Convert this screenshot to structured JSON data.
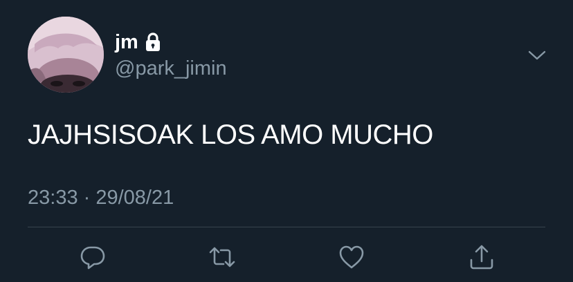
{
  "tweet": {
    "display_name": "jm",
    "handle": "@park_jimin",
    "protected_icon": "lock-icon",
    "text": "JAJHSISOAK LOS AMO MUCHO",
    "timestamp": "23:33 · 29/08/21"
  },
  "actions": [
    {
      "icon": "reply-icon"
    },
    {
      "icon": "retweet-icon"
    },
    {
      "icon": "like-icon"
    },
    {
      "icon": "share-icon"
    }
  ],
  "colors": {
    "background": "#15202b",
    "primary_text": "#ffffff",
    "secondary_text": "#8899a6",
    "divider": "#38444d"
  }
}
